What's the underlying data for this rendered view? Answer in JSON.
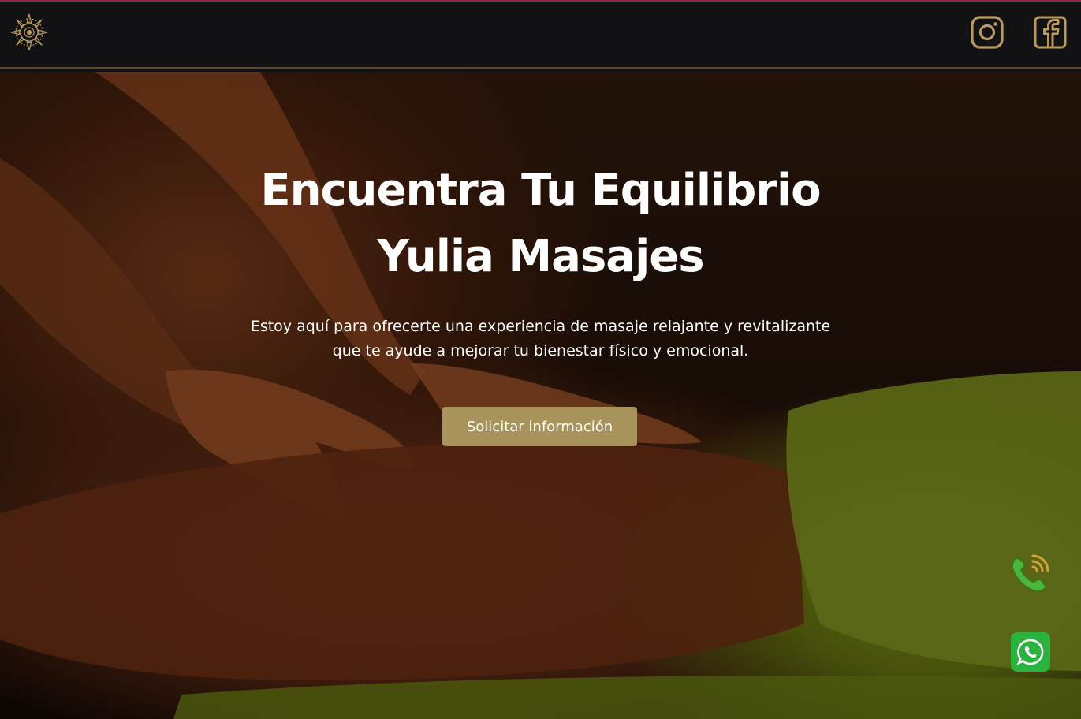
{
  "brand": {
    "logo_icon": "mandala-logo-icon",
    "accent": "#b89a5e"
  },
  "nav": {
    "social": [
      {
        "name": "instagram",
        "icon": "instagram-icon"
      },
      {
        "name": "facebook",
        "icon": "facebook-icon"
      }
    ]
  },
  "hero": {
    "title_line1": "Encuentra Tu Equilibrio",
    "title_line2": "Yulia Masajes",
    "subtitle_line1": "Estoy aquí para ofrecerte una experiencia de masaje relajante y revitalizante",
    "subtitle_line2": "que te ayude a mejorar tu bienestar físico y emocional.",
    "cta_label": "Solicitar información",
    "cta_color": "#a8935c",
    "background_image": "massage-hands-on-back-photo"
  },
  "floating": {
    "phone_icon": "phone-call-icon",
    "whatsapp_icon": "whatsapp-icon",
    "whatsapp_color": "#2bb33f"
  }
}
